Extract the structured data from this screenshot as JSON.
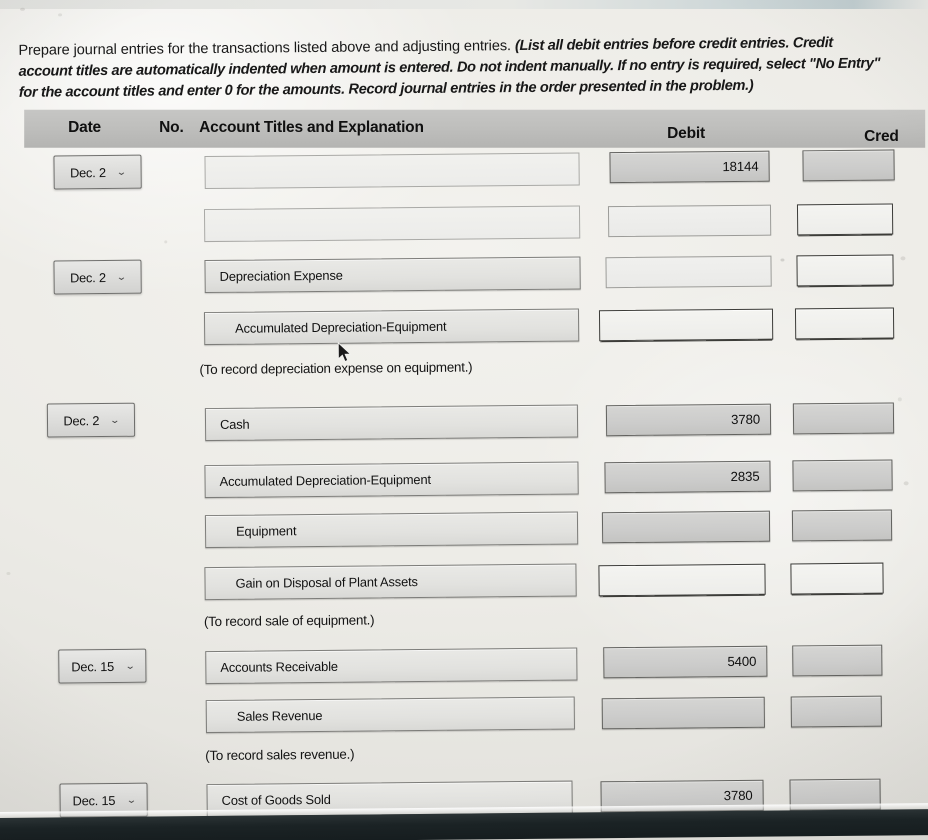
{
  "prompt": {
    "lead": "Prepare journal entries for the transactions listed above and adjusting entries. ",
    "italic": "(List all debit entries before credit entries. Credit account titles are automatically indented when amount is entered. Do not indent manually. If no entry is required, select \"No Entry\" for the account titles and enter 0 for the amounts. Record journal entries in the order presented in the problem.)"
  },
  "table": {
    "headers": {
      "date": "Date",
      "no": "No.",
      "account": "Account Titles and Explanation",
      "debit": "Debit",
      "credit": "Cred"
    },
    "rows": [
      {
        "date": "Dec. 2",
        "account": "",
        "debit": "18144",
        "credit": ""
      },
      {
        "date": "",
        "account": "",
        "debit": "",
        "credit": ""
      },
      {
        "date": "Dec. 2",
        "account": "Depreciation Expense",
        "debit": "",
        "credit": ""
      },
      {
        "date": "",
        "account": "Accumulated Depreciation-Equipment",
        "debit": "",
        "credit": ""
      },
      {
        "date": "Dec. 2",
        "account": "Cash",
        "debit": "3780",
        "credit": ""
      },
      {
        "date": "",
        "account": "Accumulated Depreciation-Equipment",
        "debit": "2835",
        "credit": ""
      },
      {
        "date": "",
        "account": "Equipment",
        "debit": "",
        "credit": ""
      },
      {
        "date": "",
        "account": "Gain on Disposal of Plant Assets",
        "debit": "",
        "credit": ""
      },
      {
        "date": "Dec. 15",
        "account": "Accounts Receivable",
        "debit": "5400",
        "credit": ""
      },
      {
        "date": "",
        "account": "Sales Revenue",
        "debit": "",
        "credit": ""
      },
      {
        "date": "Dec. 15",
        "account": "Cost of Goods Sold",
        "debit": "3780",
        "credit": ""
      }
    ],
    "memos": [
      "(To record depreciation expense on equipment.)",
      "(To record sale of equipment.)",
      "(To record sales revenue.)"
    ],
    "dropdown_icon": "chevron-down-icon"
  },
  "colors": {
    "header_band": "#bfbfbd",
    "field_fill": "#e2e2df",
    "amount_fill": "#cccccb",
    "page": "#ecebe6",
    "text": "#111111"
  }
}
